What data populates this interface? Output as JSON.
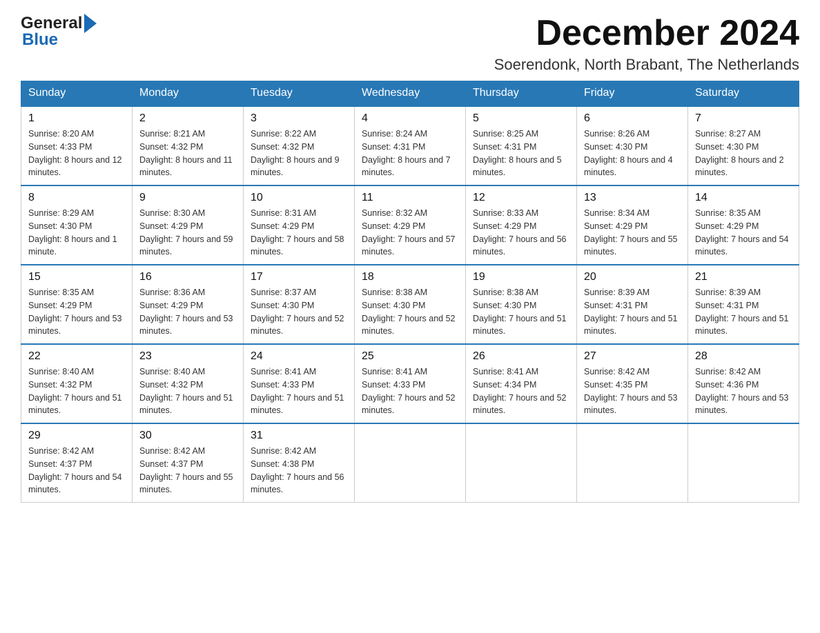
{
  "header": {
    "logo_general": "General",
    "logo_blue": "Blue",
    "month_title": "December 2024",
    "subtitle": "Soerendonk, North Brabant, The Netherlands"
  },
  "days_of_week": [
    "Sunday",
    "Monday",
    "Tuesday",
    "Wednesday",
    "Thursday",
    "Friday",
    "Saturday"
  ],
  "weeks": [
    [
      {
        "day": "1",
        "sunrise": "8:20 AM",
        "sunset": "4:33 PM",
        "daylight": "8 hours and 12 minutes."
      },
      {
        "day": "2",
        "sunrise": "8:21 AM",
        "sunset": "4:32 PM",
        "daylight": "8 hours and 11 minutes."
      },
      {
        "day": "3",
        "sunrise": "8:22 AM",
        "sunset": "4:32 PM",
        "daylight": "8 hours and 9 minutes."
      },
      {
        "day": "4",
        "sunrise": "8:24 AM",
        "sunset": "4:31 PM",
        "daylight": "8 hours and 7 minutes."
      },
      {
        "day": "5",
        "sunrise": "8:25 AM",
        "sunset": "4:31 PM",
        "daylight": "8 hours and 5 minutes."
      },
      {
        "day": "6",
        "sunrise": "8:26 AM",
        "sunset": "4:30 PM",
        "daylight": "8 hours and 4 minutes."
      },
      {
        "day": "7",
        "sunrise": "8:27 AM",
        "sunset": "4:30 PM",
        "daylight": "8 hours and 2 minutes."
      }
    ],
    [
      {
        "day": "8",
        "sunrise": "8:29 AM",
        "sunset": "4:30 PM",
        "daylight": "8 hours and 1 minute."
      },
      {
        "day": "9",
        "sunrise": "8:30 AM",
        "sunset": "4:29 PM",
        "daylight": "7 hours and 59 minutes."
      },
      {
        "day": "10",
        "sunrise": "8:31 AM",
        "sunset": "4:29 PM",
        "daylight": "7 hours and 58 minutes."
      },
      {
        "day": "11",
        "sunrise": "8:32 AM",
        "sunset": "4:29 PM",
        "daylight": "7 hours and 57 minutes."
      },
      {
        "day": "12",
        "sunrise": "8:33 AM",
        "sunset": "4:29 PM",
        "daylight": "7 hours and 56 minutes."
      },
      {
        "day": "13",
        "sunrise": "8:34 AM",
        "sunset": "4:29 PM",
        "daylight": "7 hours and 55 minutes."
      },
      {
        "day": "14",
        "sunrise": "8:35 AM",
        "sunset": "4:29 PM",
        "daylight": "7 hours and 54 minutes."
      }
    ],
    [
      {
        "day": "15",
        "sunrise": "8:35 AM",
        "sunset": "4:29 PM",
        "daylight": "7 hours and 53 minutes."
      },
      {
        "day": "16",
        "sunrise": "8:36 AM",
        "sunset": "4:29 PM",
        "daylight": "7 hours and 53 minutes."
      },
      {
        "day": "17",
        "sunrise": "8:37 AM",
        "sunset": "4:30 PM",
        "daylight": "7 hours and 52 minutes."
      },
      {
        "day": "18",
        "sunrise": "8:38 AM",
        "sunset": "4:30 PM",
        "daylight": "7 hours and 52 minutes."
      },
      {
        "day": "19",
        "sunrise": "8:38 AM",
        "sunset": "4:30 PM",
        "daylight": "7 hours and 51 minutes."
      },
      {
        "day": "20",
        "sunrise": "8:39 AM",
        "sunset": "4:31 PM",
        "daylight": "7 hours and 51 minutes."
      },
      {
        "day": "21",
        "sunrise": "8:39 AM",
        "sunset": "4:31 PM",
        "daylight": "7 hours and 51 minutes."
      }
    ],
    [
      {
        "day": "22",
        "sunrise": "8:40 AM",
        "sunset": "4:32 PM",
        "daylight": "7 hours and 51 minutes."
      },
      {
        "day": "23",
        "sunrise": "8:40 AM",
        "sunset": "4:32 PM",
        "daylight": "7 hours and 51 minutes."
      },
      {
        "day": "24",
        "sunrise": "8:41 AM",
        "sunset": "4:33 PM",
        "daylight": "7 hours and 51 minutes."
      },
      {
        "day": "25",
        "sunrise": "8:41 AM",
        "sunset": "4:33 PM",
        "daylight": "7 hours and 52 minutes."
      },
      {
        "day": "26",
        "sunrise": "8:41 AM",
        "sunset": "4:34 PM",
        "daylight": "7 hours and 52 minutes."
      },
      {
        "day": "27",
        "sunrise": "8:42 AM",
        "sunset": "4:35 PM",
        "daylight": "7 hours and 53 minutes."
      },
      {
        "day": "28",
        "sunrise": "8:42 AM",
        "sunset": "4:36 PM",
        "daylight": "7 hours and 53 minutes."
      }
    ],
    [
      {
        "day": "29",
        "sunrise": "8:42 AM",
        "sunset": "4:37 PM",
        "daylight": "7 hours and 54 minutes."
      },
      {
        "day": "30",
        "sunrise": "8:42 AM",
        "sunset": "4:37 PM",
        "daylight": "7 hours and 55 minutes."
      },
      {
        "day": "31",
        "sunrise": "8:42 AM",
        "sunset": "4:38 PM",
        "daylight": "7 hours and 56 minutes."
      },
      null,
      null,
      null,
      null
    ]
  ],
  "labels": {
    "sunrise": "Sunrise:",
    "sunset": "Sunset:",
    "daylight": "Daylight:"
  },
  "colors": {
    "header_bg": "#2878b5",
    "accent_blue": "#1a6ab5"
  }
}
